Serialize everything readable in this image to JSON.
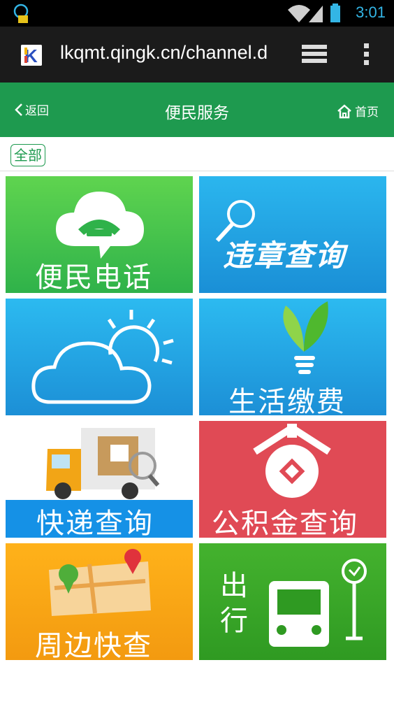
{
  "status_bar": {
    "time": "3:01"
  },
  "browser": {
    "url": "lkqmt.qingk.cn/channel.d"
  },
  "header": {
    "back_label": "返回",
    "title": "便民服务",
    "home_label": "首页"
  },
  "filter": {
    "chip_label": "全部"
  },
  "tiles": [
    {
      "label": "便民电话"
    },
    {
      "label": "违章查询"
    },
    {
      "label": ""
    },
    {
      "label": "生活缴费"
    },
    {
      "label": "快递查询"
    },
    {
      "label": "公积金查询"
    },
    {
      "label": "周边快查"
    },
    {
      "label": "出行"
    }
  ],
  "colors": {
    "header_green": "#1e9a4f",
    "accent_blue": "#33b5e5"
  }
}
